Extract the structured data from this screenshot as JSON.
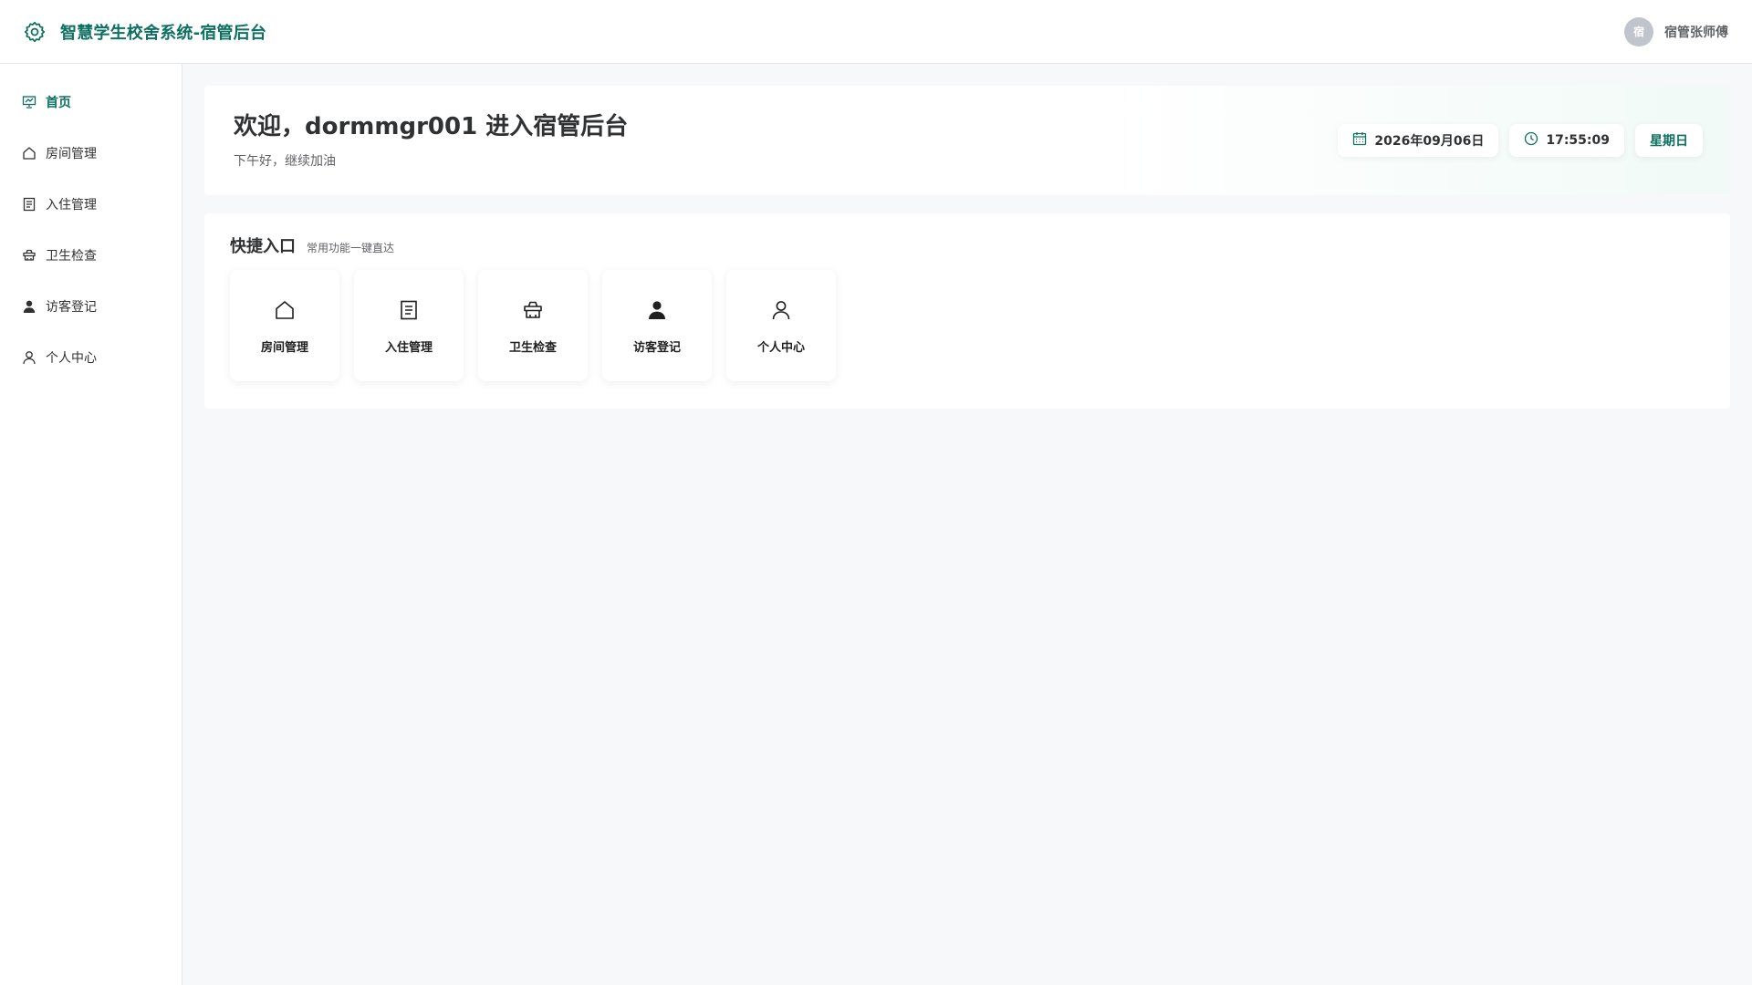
{
  "header": {
    "title": "智慧学生校舍系统-宿管后台",
    "brand_icon": "gear-icon",
    "avatar_text": "宿",
    "user_name": "宿管张师傅"
  },
  "sidebar": {
    "items": [
      {
        "label": "首页",
        "icon": "dashboard-icon",
        "active": true
      },
      {
        "label": "房间管理",
        "icon": "home-icon"
      },
      {
        "label": "入住管理",
        "icon": "document-icon"
      },
      {
        "label": "卫生检查",
        "icon": "brush-icon"
      },
      {
        "label": "访客登记",
        "icon": "user-filled-icon"
      },
      {
        "label": "个人中心",
        "icon": "user-icon"
      }
    ]
  },
  "welcome": {
    "title": "欢迎，dormmgr001 进入宿管后台",
    "subtitle": "下午好，继续加油",
    "date": "2026年09月06日",
    "time": "17:55:09",
    "weekday": "星期日"
  },
  "quick": {
    "title": "快捷入口",
    "subtitle": "常用功能一键直达",
    "tiles": [
      {
        "label": "房间管理",
        "icon": "home-icon"
      },
      {
        "label": "入住管理",
        "icon": "document-icon"
      },
      {
        "label": "卫生检查",
        "icon": "brush-icon"
      },
      {
        "label": "访客登记",
        "icon": "user-filled-icon"
      },
      {
        "label": "个人中心",
        "icon": "user-icon"
      }
    ]
  },
  "colors": {
    "accent": "#0d7060",
    "background": "#f6f8fa",
    "text": "#303133"
  }
}
